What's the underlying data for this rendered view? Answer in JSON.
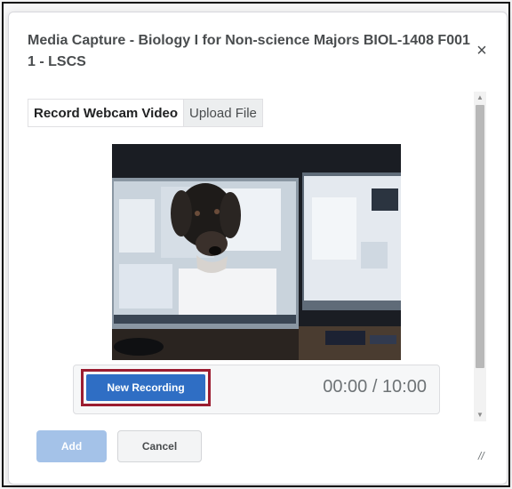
{
  "dialog": {
    "title": "Media Capture - Biology I for Non-science Majors BIOL-1408 F001 1 - LSCS",
    "close_icon": "×"
  },
  "tabs": [
    {
      "label": "Record Webcam Video",
      "active": true
    },
    {
      "label": "Upload File",
      "active": false
    }
  ],
  "video": {
    "preview": "webcam-preview"
  },
  "recorder": {
    "new_recording_label": "New Recording",
    "timer": "00:00 / 10:00"
  },
  "footer": {
    "add_label": "Add",
    "cancel_label": "Cancel"
  },
  "scrollbar": {
    "up_icon": "▲",
    "down_icon": "▼"
  },
  "resize_icon": "//",
  "colors": {
    "primary": "#2f6ec4",
    "highlight": "#9b1c30",
    "add_disabled": "#a4c2e8"
  }
}
